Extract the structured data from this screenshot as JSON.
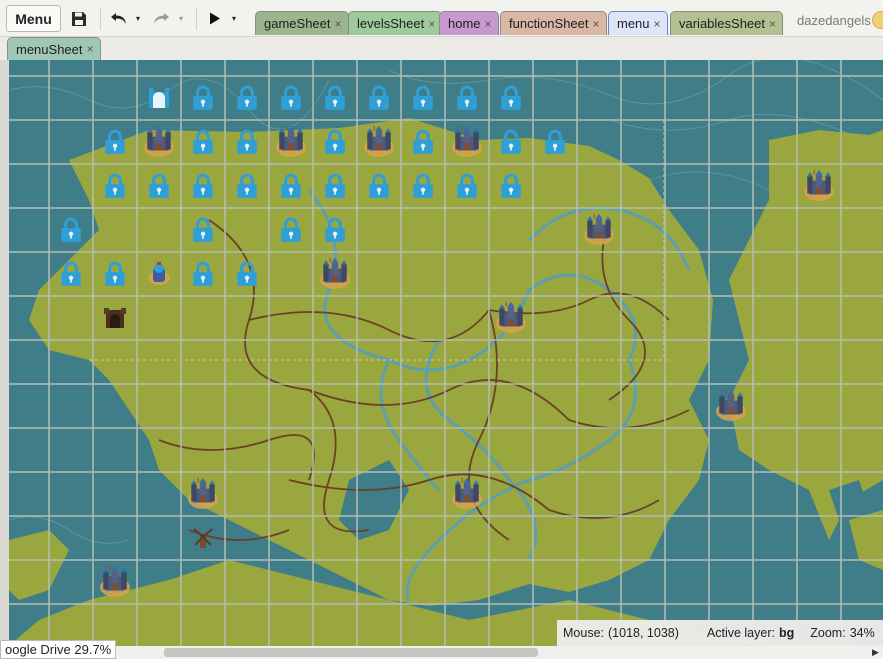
{
  "toolbar": {
    "menu_label": "Menu",
    "save_icon": "save-icon",
    "undo_icon": "undo-icon",
    "redo_icon": "redo-icon",
    "play_icon": "play-icon",
    "dropdown_glyph": "▾"
  },
  "tabs": [
    {
      "label": "gameSheet",
      "color": "#9cb58e"
    },
    {
      "label": "levelsSheet",
      "color": "#9fca9c"
    },
    {
      "label": "home",
      "color": "#c69ad0"
    },
    {
      "label": "functionSheet",
      "color": "#d9b6a6"
    },
    {
      "label": "menu",
      "color": "#dde6f8",
      "active": true
    },
    {
      "label": "variablesSheet",
      "color": "#b4bf92"
    },
    {
      "label": "menuSheet",
      "color": "#9fc7b8"
    }
  ],
  "close_glyph": "×",
  "user": {
    "name": "dazedangels"
  },
  "status": {
    "mouse_label": "Mouse:",
    "mouse_value": "(1018, 1038)",
    "layer_label": "Active layer:",
    "layer_value": "bg",
    "zoom_label": "Zoom:",
    "zoom_value": "34%"
  },
  "gdrive_badge": "oogle Drive 29.7%",
  "map": {
    "grid_columns": 20,
    "grid_rows": 14,
    "colors": {
      "water": "#3f7d88",
      "land": "#9aa63e",
      "river": "#5b9fb1",
      "border": "#6b4128",
      "lock": "#2f9fd6",
      "grid": "#b5bfb6"
    },
    "locked_cells": [
      [
        4,
        2
      ],
      [
        5,
        2
      ],
      [
        6,
        2
      ],
      [
        7,
        2
      ],
      [
        8,
        2
      ],
      [
        9,
        2
      ],
      [
        10,
        2
      ],
      [
        11,
        2
      ],
      [
        2,
        3
      ],
      [
        4,
        3
      ],
      [
        5,
        3
      ],
      [
        7,
        3
      ],
      [
        9,
        3
      ],
      [
        11,
        3
      ],
      [
        12,
        3
      ],
      [
        2,
        4
      ],
      [
        3,
        4
      ],
      [
        4,
        4
      ],
      [
        5,
        4
      ],
      [
        6,
        4
      ],
      [
        7,
        4
      ],
      [
        8,
        4
      ],
      [
        9,
        4
      ],
      [
        10,
        4
      ],
      [
        11,
        4
      ],
      [
        1,
        5
      ],
      [
        4,
        5
      ],
      [
        6,
        5
      ],
      [
        7,
        5
      ],
      [
        1,
        6
      ],
      [
        2,
        6
      ],
      [
        4,
        6
      ],
      [
        5,
        6
      ]
    ],
    "castle_cells": [
      [
        3,
        3
      ],
      [
        6,
        3
      ],
      [
        8,
        3
      ],
      [
        10,
        3
      ],
      [
        13,
        5
      ],
      [
        18,
        4
      ],
      [
        7,
        6
      ],
      [
        11,
        7
      ],
      [
        16,
        9
      ],
      [
        4,
        11
      ],
      [
        10,
        11
      ],
      [
        2,
        13
      ]
    ],
    "special_cells": [
      {
        "cell": [
          3,
          2
        ],
        "icon": "open-gate-icon"
      },
      {
        "cell": [
          3,
          6
        ],
        "icon": "knight-icon"
      },
      {
        "cell": [
          2,
          7
        ],
        "icon": "dark-gate-icon"
      },
      {
        "cell": [
          4,
          12
        ],
        "icon": "windmill-icon"
      }
    ]
  }
}
